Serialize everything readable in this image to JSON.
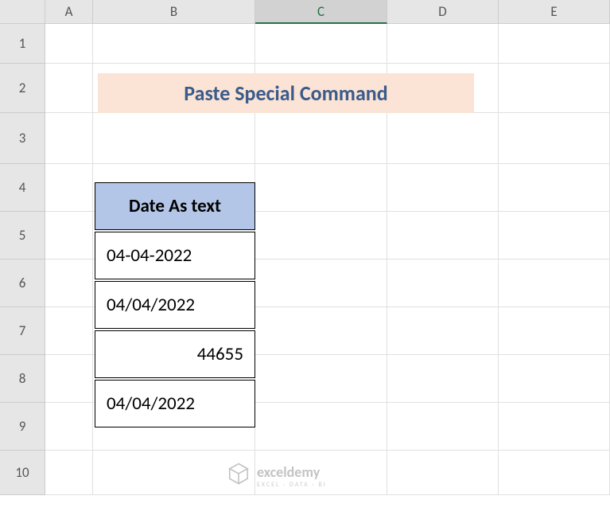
{
  "columns": {
    "A": "A",
    "B": "B",
    "C": "C",
    "D": "D",
    "E": "E"
  },
  "rows": {
    "1": "1",
    "2": "2",
    "3": "3",
    "4": "4",
    "5": "5",
    "6": "6",
    "7": "7",
    "8": "8",
    "9": "9",
    "10": "10"
  },
  "active_column": "C",
  "title": "Paste Special Command",
  "table": {
    "header": "Date As text",
    "rows": [
      {
        "value": "04-04-2022",
        "align": "left"
      },
      {
        "value": "04/04/2022",
        "align": "left"
      },
      {
        "value": "44655",
        "align": "right"
      },
      {
        "value": "04/04/2022",
        "align": "left"
      }
    ]
  },
  "watermark": {
    "brand": "exceldemy",
    "tagline": "EXCEL · DATA · BI"
  }
}
